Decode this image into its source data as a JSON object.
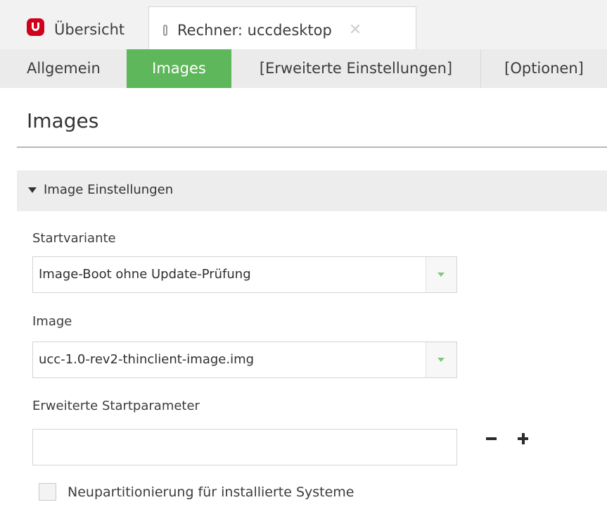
{
  "top_tabs": {
    "overview_label": "Übersicht",
    "rechner_label": "Rechner: uccdesktop"
  },
  "sub_tabs": {
    "allgemein": "Allgemein",
    "images": "Images",
    "erweiterte": "[Erweiterte Einstellungen]",
    "optionen": "[Optionen]"
  },
  "page": {
    "title": "Images"
  },
  "section": {
    "title": "Image Einstellungen"
  },
  "fields": {
    "startvariante_label": "Startvariante",
    "startvariante_value": "Image-Boot ohne Update-Prüfung",
    "image_label": "Image",
    "image_value": "ucc-1.0-rev2-thinclient-image.img",
    "startparameter_label": "Erweiterte Startparameter",
    "startparameter_value": "",
    "repartition_label": "Neupartitionierung für installierte Systeme"
  },
  "colors": {
    "active_tab": "#5fb75b",
    "brand_logo": "#d0021b"
  }
}
